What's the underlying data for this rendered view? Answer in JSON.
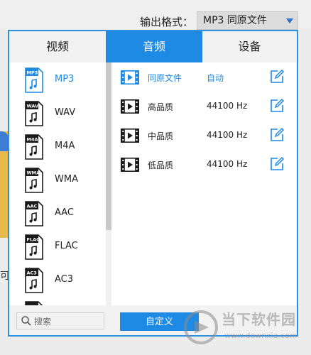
{
  "header": {
    "format_label": "输出格式：",
    "format_value": "MP3  同原文件"
  },
  "tabs": [
    {
      "label": "视频",
      "active": false
    },
    {
      "label": "音频",
      "active": true
    },
    {
      "label": "设备",
      "active": false
    }
  ],
  "formats": [
    {
      "badge": "MP3",
      "label": "MP3",
      "active": true
    },
    {
      "badge": "WAV",
      "label": "WAV",
      "active": false
    },
    {
      "badge": "M4A",
      "label": "M4A",
      "active": false
    },
    {
      "badge": "WMA",
      "label": "WMA",
      "active": false
    },
    {
      "badge": "AAC",
      "label": "AAC",
      "active": false
    },
    {
      "badge": "FLAC",
      "label": "FLAC",
      "active": false
    },
    {
      "badge": "AC3",
      "label": "AC3",
      "active": false
    }
  ],
  "qualities": [
    {
      "name": "同原文件",
      "rate": "自动",
      "active": true
    },
    {
      "name": "高品质",
      "rate": "44100 Hz",
      "active": false
    },
    {
      "name": "中品质",
      "rate": "44100 Hz",
      "active": false
    },
    {
      "name": "低品质",
      "rate": "44100 Hz",
      "active": false
    }
  ],
  "bottom": {
    "search_placeholder": "搜索",
    "custom_label": "自定义"
  },
  "watermark": {
    "title": "当下软件园",
    "url": "www.downxia.com"
  },
  "background": {
    "fragment_char": "可"
  },
  "colors": {
    "accent": "#1f8ae3",
    "border": "#2c8fe0"
  }
}
